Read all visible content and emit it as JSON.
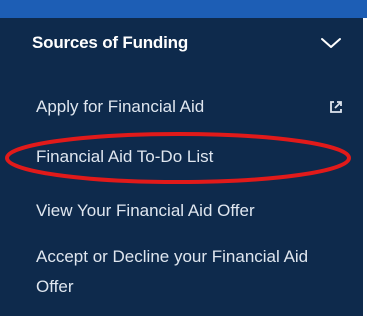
{
  "sidebar": {
    "section_title": "Sources of Funding",
    "items": [
      {
        "label": "Apply for Financial Aid",
        "icon": "external-link-icon"
      },
      {
        "label": "Financial Aid To-Do List"
      },
      {
        "label": "View Your Financial Aid Offer"
      },
      {
        "label": "Accept or Decline your Financial Aid Offer"
      }
    ]
  },
  "colors": {
    "panel_bg": "#0e2a4c",
    "top_strip": "#1d5eb5",
    "annotation_red": "#e11a1a",
    "text": "#dfe6ef"
  }
}
